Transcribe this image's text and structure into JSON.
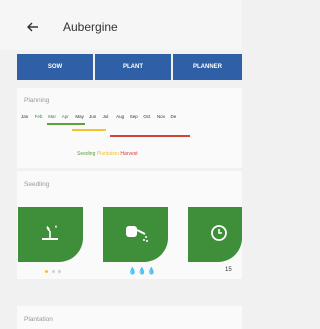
{
  "header": {
    "title": "Aubergine",
    "back_icon": "back-arrow-icon"
  },
  "tabs": [
    {
      "label": "SOW"
    },
    {
      "label": "PLANT"
    },
    {
      "label": "PLANNER"
    }
  ],
  "planning": {
    "title": "Planning",
    "months": [
      "Jan",
      "Feb",
      "Mar",
      "Apr",
      "May",
      "Jun",
      "Jul",
      "Aug",
      "Sep",
      "Oct",
      "Nov",
      "De"
    ],
    "legend": {
      "seeding": "Seeding",
      "plantation": "Plantation",
      "harvest": "Harvest"
    },
    "colors": {
      "seeding": "#5aa33a",
      "plantation": "#f2c530",
      "harvest": "#d8403a"
    }
  },
  "seedling": {
    "title": "Seedling",
    "tiles": [
      {
        "icon": "sowing-hand-icon",
        "rating": 1,
        "of": 3
      },
      {
        "icon": "watering-can-icon",
        "drops": "💧💧💧"
      },
      {
        "icon": "clock-icon",
        "value": "15"
      }
    ]
  },
  "plantation": {
    "title": "Plantation"
  },
  "colors": {
    "tab_bg": "#2f5fa6",
    "tile_bg": "#3f8f3a",
    "rating_on": "#f2c530",
    "rating_off": "#cfcfcf"
  }
}
